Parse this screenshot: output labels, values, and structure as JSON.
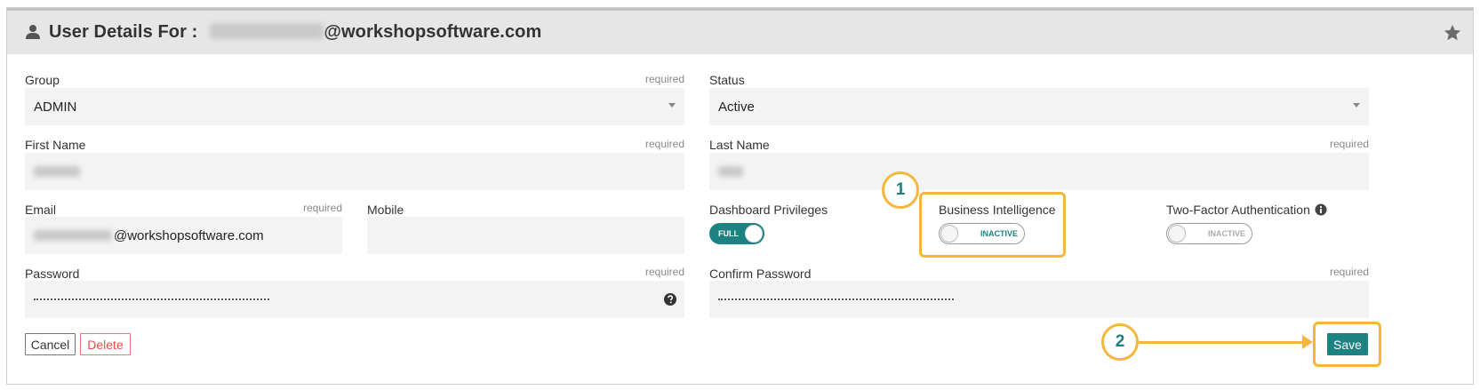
{
  "header": {
    "title_prefix": "User Details For :",
    "email_domain": "@workshopsoftware.com",
    "user_icon": "user-icon",
    "star_icon": "star-icon"
  },
  "form": {
    "required_text": "required",
    "group": {
      "label": "Group",
      "value": "ADMIN"
    },
    "status": {
      "label": "Status",
      "value": "Active"
    },
    "first_name": {
      "label": "First Name"
    },
    "last_name": {
      "label": "Last Name"
    },
    "email": {
      "label": "Email",
      "domain": "@workshopsoftware.com"
    },
    "mobile": {
      "label": "Mobile",
      "value": ""
    },
    "dashboard_privileges": {
      "label": "Dashboard Privileges",
      "state": "FULL"
    },
    "business_intelligence": {
      "label": "Business Intelligence",
      "state": "INACTIVE"
    },
    "two_factor": {
      "label": "Two-Factor Authentication",
      "state": "INACTIVE",
      "info_icon": "info-icon"
    },
    "password": {
      "label": "Password",
      "help_icon": "help-icon"
    },
    "confirm_password": {
      "label": "Confirm Password"
    }
  },
  "buttons": {
    "cancel": "Cancel",
    "delete": "Delete",
    "save": "Save"
  },
  "annotations": {
    "badge_1": "1",
    "badge_2": "2",
    "color": "#f5b73b"
  },
  "colors": {
    "accent": "#1d8282",
    "danger": "#e24c4c",
    "header_bg": "#e6e6e6"
  }
}
